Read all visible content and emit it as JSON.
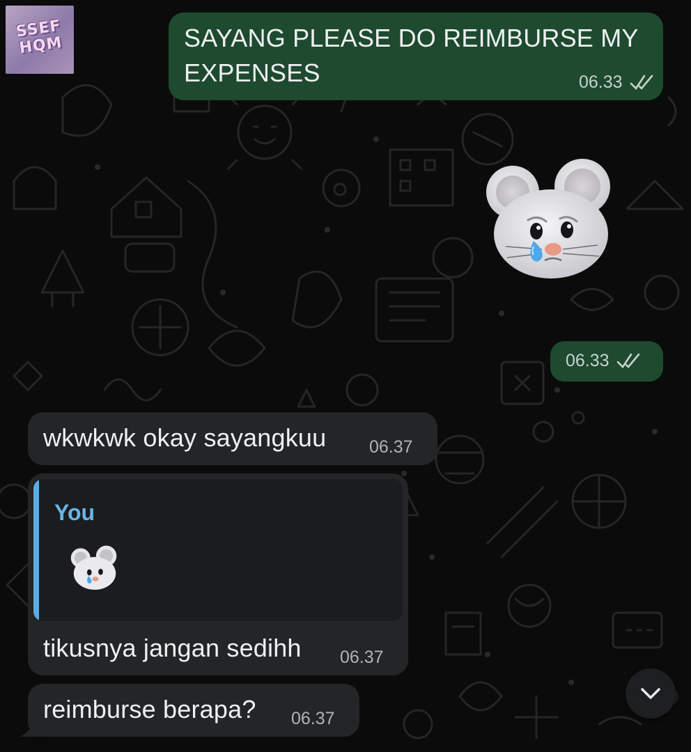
{
  "chat": {
    "messages": [
      {
        "direction": "outgoing",
        "text": "SAYANG PLEASE DO REIMBURSE MY EXPENSES",
        "time": "06.33",
        "status": "read"
      },
      {
        "direction": "outgoing",
        "type": "sticker",
        "sticker": "crying-mouse-memoji",
        "time": "06.33",
        "status": "read"
      },
      {
        "direction": "incoming",
        "text": "wkwkwk okay sayangkuu",
        "time": "06.37"
      },
      {
        "direction": "incoming",
        "reply_to": {
          "sender": "You",
          "preview": "crying-mouse-memoji"
        },
        "text": "tikusnya jangan sedihh",
        "time": "06.37"
      },
      {
        "direction": "incoming",
        "text": "reimburse berapa?",
        "time": "06.37"
      }
    ]
  },
  "icons": {
    "read_receipt": "double-check-icon",
    "scroll_down": "chevron-down-icon"
  },
  "colors": {
    "outgoing_bubble": "#1e4a2f",
    "incoming_bubble": "#232526",
    "reply_accent": "#5aaee6",
    "background": "#0b0b0b"
  }
}
